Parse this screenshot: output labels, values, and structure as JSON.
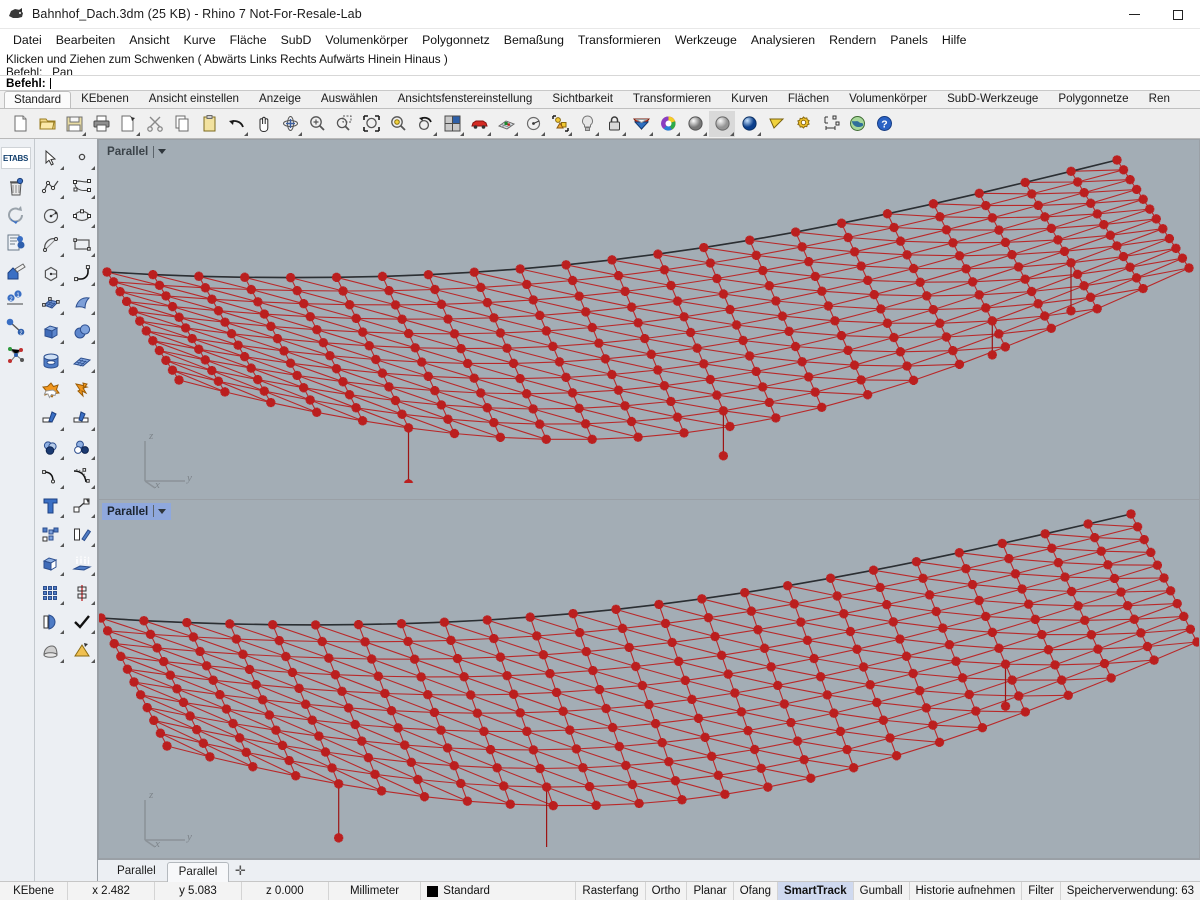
{
  "window": {
    "title": "Bahnhof_Dach.3dm (25 KB) - Rhino 7 Not-For-Resale-Lab",
    "app_icon": "rhino-app-icon",
    "controls": [
      {
        "name": "minimize-button",
        "glyph": "minimize-icon"
      },
      {
        "name": "maximize-button",
        "glyph": "maximize-icon"
      }
    ]
  },
  "menubar": {
    "items": [
      {
        "label": "Datei",
        "name": "menu-datei"
      },
      {
        "label": "Bearbeiten",
        "name": "menu-bearbeiten"
      },
      {
        "label": "Ansicht",
        "name": "menu-ansicht"
      },
      {
        "label": "Kurve",
        "name": "menu-kurve"
      },
      {
        "label": "Fläche",
        "name": "menu-flaeche"
      },
      {
        "label": "SubD",
        "name": "menu-subd"
      },
      {
        "label": "Volumenkörper",
        "name": "menu-volumenkoerper"
      },
      {
        "label": "Polygonnetz",
        "name": "menu-polygonnetz"
      },
      {
        "label": "Bemaßung",
        "name": "menu-bemassung"
      },
      {
        "label": "Transformieren",
        "name": "menu-transformieren"
      },
      {
        "label": "Werkzeuge",
        "name": "menu-werkzeuge"
      },
      {
        "label": "Analysieren",
        "name": "menu-analysieren"
      },
      {
        "label": "Rendern",
        "name": "menu-rendern"
      },
      {
        "label": "Panels",
        "name": "menu-panels"
      },
      {
        "label": "Hilfe",
        "name": "menu-hilfe"
      }
    ]
  },
  "command_area": {
    "history_line_1": "Klicken und Ziehen zum Schwenken ( Abwärts  Links  Rechts  Aufwärts  Hinein  Hinaus )",
    "history_line_2": "Befehl: _Pan",
    "prompt_label": "Befehl:",
    "prompt_value": ""
  },
  "toolbar_tabs": {
    "active": "Standard",
    "items": [
      {
        "label": "Standard",
        "name": "toolbar-tab-standard"
      },
      {
        "label": "KEbenen",
        "name": "toolbar-tab-kebenen"
      },
      {
        "label": "Ansicht einstellen",
        "name": "toolbar-tab-ansicht-einstellen"
      },
      {
        "label": "Anzeige",
        "name": "toolbar-tab-anzeige"
      },
      {
        "label": "Auswählen",
        "name": "toolbar-tab-auswaehlen"
      },
      {
        "label": "Ansichtsfenstereinstellung",
        "name": "toolbar-tab-ansichtsfenstereinstellung"
      },
      {
        "label": "Sichtbarkeit",
        "name": "toolbar-tab-sichtbarkeit"
      },
      {
        "label": "Transformieren",
        "name": "toolbar-tab-transformieren"
      },
      {
        "label": "Kurven",
        "name": "toolbar-tab-kurven"
      },
      {
        "label": "Flächen",
        "name": "toolbar-tab-flaechen"
      },
      {
        "label": "Volumenkörper",
        "name": "toolbar-tab-volumenkoerper"
      },
      {
        "label": "SubD-Werkzeuge",
        "name": "toolbar-tab-subd-werkzeuge"
      },
      {
        "label": "Polygonnetze",
        "name": "toolbar-tab-polygonnetze"
      },
      {
        "label": "Ren",
        "name": "toolbar-tab-rendern"
      }
    ]
  },
  "icon_toolbar": {
    "icons": [
      {
        "name": "new-file-icon",
        "flyout": false
      },
      {
        "name": "open-file-icon",
        "flyout": false
      },
      {
        "name": "save-file-icon",
        "flyout": true
      },
      {
        "name": "print-icon",
        "flyout": false
      },
      {
        "name": "cut-object-icon",
        "flyout": true
      },
      {
        "name": "scissors-cut-icon",
        "flyout": false
      },
      {
        "name": "copy-icon",
        "flyout": false
      },
      {
        "name": "paste-icon",
        "flyout": false
      },
      {
        "name": "undo-icon",
        "flyout": true
      },
      {
        "name": "pan-hand-icon",
        "flyout": false
      },
      {
        "name": "rotate-view-icon",
        "flyout": true
      },
      {
        "name": "zoom-in-icon",
        "flyout": false
      },
      {
        "name": "zoom-window-icon",
        "flyout": false
      },
      {
        "name": "zoom-extents-icon",
        "flyout": false
      },
      {
        "name": "zoom-selected-icon",
        "flyout": false
      },
      {
        "name": "zoom-previous-icon",
        "flyout": true
      },
      {
        "name": "viewport-layout-icon",
        "flyout": true
      },
      {
        "name": "render-car-icon",
        "flyout": true
      },
      {
        "name": "grid-snap-icon",
        "flyout": true
      },
      {
        "name": "object-snap-icon",
        "flyout": true
      },
      {
        "name": "layer-objects-icon",
        "flyout": true
      },
      {
        "name": "light-bulb-icon",
        "flyout": true
      },
      {
        "name": "lock-icon",
        "flyout": true
      },
      {
        "name": "surface-colour-icon",
        "flyout": true
      },
      {
        "name": "colour-wheel-icon",
        "flyout": true
      },
      {
        "name": "shaded-sphere-icon",
        "flyout": true
      },
      {
        "name": "ghosted-sphere-icon",
        "flyout": true
      },
      {
        "name": "rendered-sphere-icon",
        "flyout": true
      },
      {
        "name": "flat-shade-icon",
        "flyout": false
      },
      {
        "name": "options-gear-icon",
        "flyout": false
      },
      {
        "name": "dimension-icon",
        "flyout": false
      },
      {
        "name": "earth-globe-icon",
        "flyout": false
      },
      {
        "name": "help-icon",
        "flyout": false
      }
    ]
  },
  "sidebar": {
    "column_one": [
      {
        "name": "etabs-plugin-icon",
        "label": "ETABS"
      },
      {
        "name": "delete-trash-icon"
      },
      {
        "name": "undo-arrow-icon"
      },
      {
        "name": "properties-panel-icon"
      },
      {
        "name": "layer-home-icon"
      },
      {
        "name": "point-order-icon"
      },
      {
        "name": "line-two-points-icon"
      },
      {
        "name": "point-cloud-icon"
      }
    ],
    "column_two": [
      {
        "name": "select-arrow-icon",
        "flyout": true
      },
      {
        "name": "point-object-icon",
        "flyout": true
      },
      {
        "name": "polyline-icon",
        "flyout": true
      },
      {
        "name": "control-point-curve-icon",
        "flyout": true
      },
      {
        "name": "circle-icon",
        "flyout": true
      },
      {
        "name": "ellipse-icon",
        "flyout": true
      },
      {
        "name": "arc-icon",
        "flyout": true
      },
      {
        "name": "rectangle-icon",
        "flyout": true
      },
      {
        "name": "polygon-icon",
        "flyout": true
      },
      {
        "name": "curve-fillet-icon",
        "flyout": true
      },
      {
        "name": "surface-from-points-icon",
        "flyout": true
      },
      {
        "name": "surface-sweep-icon",
        "flyout": true
      },
      {
        "name": "box-solid-icon",
        "flyout": true
      },
      {
        "name": "sphere-solid-icon",
        "flyout": true
      },
      {
        "name": "cylinder-solid-icon",
        "flyout": true
      },
      {
        "name": "mesh-plane-icon",
        "flyout": true
      },
      {
        "name": "boolean-union-icon",
        "flyout": false
      },
      {
        "name": "explode-icon",
        "flyout": false
      },
      {
        "name": "trim-icon",
        "flyout": true
      },
      {
        "name": "split-icon",
        "flyout": true
      },
      {
        "name": "boolean-difference-icon",
        "flyout": true
      },
      {
        "name": "boolean-intersection-icon",
        "flyout": true
      },
      {
        "name": "fillet-curve-icon",
        "flyout": true
      },
      {
        "name": "blend-curve-icon",
        "flyout": true
      },
      {
        "name": "text-object-icon",
        "flyout": true
      },
      {
        "name": "scale-icon",
        "flyout": true
      },
      {
        "name": "array-icon",
        "flyout": true
      },
      {
        "name": "move-copy-icon",
        "flyout": true
      },
      {
        "name": "extrude-solid-icon",
        "flyout": true
      },
      {
        "name": "offset-surface-icon",
        "flyout": true
      },
      {
        "name": "rectangular-array-icon",
        "flyout": true
      },
      {
        "name": "mirror-icon",
        "flyout": true
      },
      {
        "name": "unroll-surface-icon",
        "flyout": true
      },
      {
        "name": "check-object-icon",
        "flyout": true
      },
      {
        "name": "cone-solid-icon",
        "flyout": true
      },
      {
        "name": "pyramid-solid-icon",
        "flyout": true
      }
    ]
  },
  "viewports": [
    {
      "name": "viewport-top",
      "projection_label": "Parallel",
      "selected": false,
      "axes": {
        "z": "z",
        "y": "y",
        "x": "x"
      },
      "background": "#a3adb5"
    },
    {
      "name": "viewport-bottom",
      "projection_label": "Parallel",
      "selected": true,
      "axes": {
        "z": "z",
        "y": "y",
        "x": "x"
      },
      "background": "#a3adb5"
    }
  ],
  "viewport_tabs": {
    "active_index": 1,
    "items": [
      {
        "label": "Parallel",
        "name": "viewport-tab-parallel-1"
      },
      {
        "label": "Parallel",
        "name": "viewport-tab-parallel-2"
      }
    ],
    "add_label": "✛"
  },
  "statusbar": {
    "layer_label": "KEbene",
    "coord_x": "x 2.482",
    "coord_y": "y 5.083",
    "coord_z": "z 0.000",
    "units": "Millimeter",
    "layer_name": "Standard",
    "layer_color": "#000000",
    "toggles": [
      {
        "label": "Rasterfang",
        "name": "status-rasterfang",
        "on": false
      },
      {
        "label": "Ortho",
        "name": "status-ortho",
        "on": false
      },
      {
        "label": "Planar",
        "name": "status-planar",
        "on": false
      },
      {
        "label": "Ofang",
        "name": "status-ofang",
        "on": false
      },
      {
        "label": "SmartTrack",
        "name": "status-smarttrack",
        "on": true
      },
      {
        "label": "Gumball",
        "name": "status-gumball",
        "on": false
      },
      {
        "label": "Historie aufnehmen",
        "name": "status-historie",
        "on": false
      },
      {
        "label": "Filter",
        "name": "status-filter",
        "on": false
      },
      {
        "label": "Speicherverwendung: 63",
        "name": "status-speicherverwendung",
        "on": false
      }
    ]
  },
  "model": {
    "geometry_name": "gridshell-roof-mesh",
    "mesh_color": "#bb1f1f",
    "edge_curve_color": "#2a2f33",
    "description": "Station roof gridshell — doubly-curved quad mesh with node markers and vertical support droppers"
  }
}
